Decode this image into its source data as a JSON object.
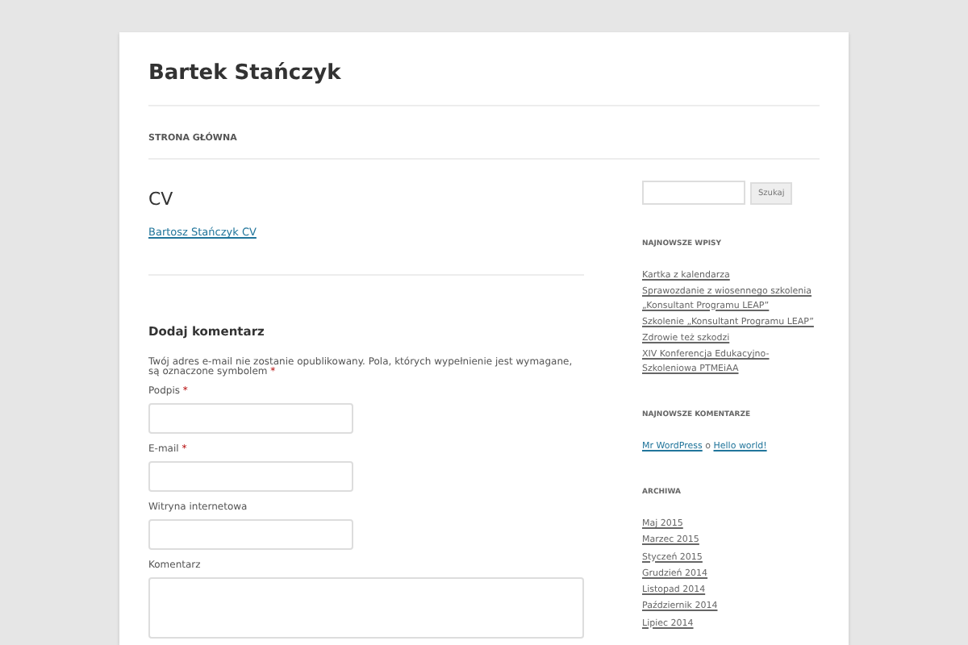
{
  "site": {
    "title": "Bartek Stańczyk"
  },
  "nav": [
    {
      "label": "STRONA GŁÓWNA",
      "selected": true
    }
  ],
  "page": {
    "title": "CV",
    "link": "Bartosz Stańczyk CV"
  },
  "comment_form": {
    "heading": "Dodaj komentarz",
    "note": "Twój adres e-mail nie zostanie opublikowany. Pola, których wypełnienie jest wymagane, są oznaczone symbolem",
    "note_mark": "*",
    "fields": [
      {
        "label": "Podpis",
        "kind": "input",
        "required_mark": "*"
      },
      {
        "label": "E-mail",
        "kind": "input",
        "required_mark": "*"
      },
      {
        "label": "Witryna internetowa",
        "kind": "input"
      },
      {
        "label": "Komentarz",
        "kind": "textarea"
      }
    ]
  },
  "sidebar": {
    "search_button": "Szukaj",
    "recent_posts": {
      "heading": "NAJNOWSZE WPISY",
      "items": [
        "Kartka z kalendarza",
        "Sprawozdanie z wiosennego szkolenia „Konsultant Programu LEAP”",
        "Szkolenie „Konsultant Programu LEAP”",
        "Zdrowie też szkodzi",
        "XIV Konferencja Edukacyjno-Szkoleniowa PTMEiAA"
      ]
    },
    "recent_comments": {
      "heading": "NAJNOWSZE KOMENTARZE",
      "items": [
        {
          "author": "Mr WordPress",
          "joiner": "o",
          "post": "Hello world!"
        }
      ]
    },
    "archives": {
      "heading": "ARCHIWA",
      "items": [
        "Maj 2015",
        "Marzec 2015",
        "Styczeń 2015",
        "Grudzień 2014",
        "Listopad 2014",
        "Październik 2014",
        "Lipiec 2014"
      ]
    }
  }
}
